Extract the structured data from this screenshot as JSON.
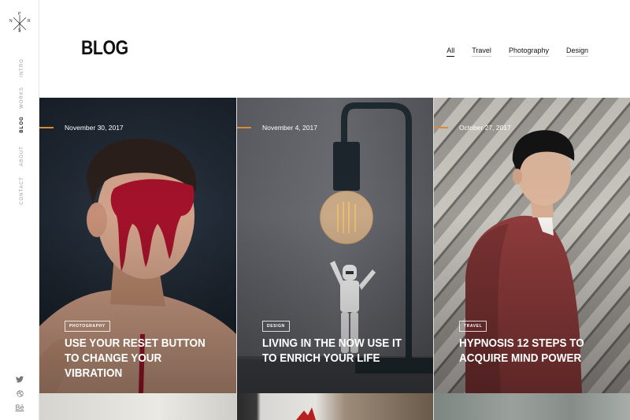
{
  "logo": {
    "top": "P",
    "left": "N",
    "right": "R",
    "bottom": "S"
  },
  "side_nav": {
    "items": [
      {
        "label": "INTRO"
      },
      {
        "label": "WORKS"
      },
      {
        "label": "BLOG"
      },
      {
        "label": "ABOUT"
      },
      {
        "label": "CONTACT"
      }
    ],
    "active": "BLOG"
  },
  "socials": {
    "twitter": "twitter-icon",
    "dribbble": "dribbble-icon",
    "behance": "Bē"
  },
  "header": {
    "title": "BLOG"
  },
  "filters": [
    {
      "label": "All"
    },
    {
      "label": "Travel"
    },
    {
      "label": "Photography"
    },
    {
      "label": "Design"
    }
  ],
  "posts": [
    {
      "date": "November 30, 2017",
      "tag": "PHOTOGRAPHY",
      "title": "USE YOUR RESET BUTTON TO CHANGE YOUR VIBRATION"
    },
    {
      "date": "November 4, 2017",
      "tag": "DESIGN",
      "title": "LIVING IN THE NOW USE IT TO ENRICH YOUR LIFE"
    },
    {
      "date": "October 27, 2017",
      "tag": "TRAVEL",
      "title": "HYPNOSIS 12 STEPS TO ACQUIRE MIND POWER"
    }
  ],
  "colors": {
    "accent": "#d98b3a",
    "text": "#111111",
    "muted": "#9a9a9a"
  }
}
